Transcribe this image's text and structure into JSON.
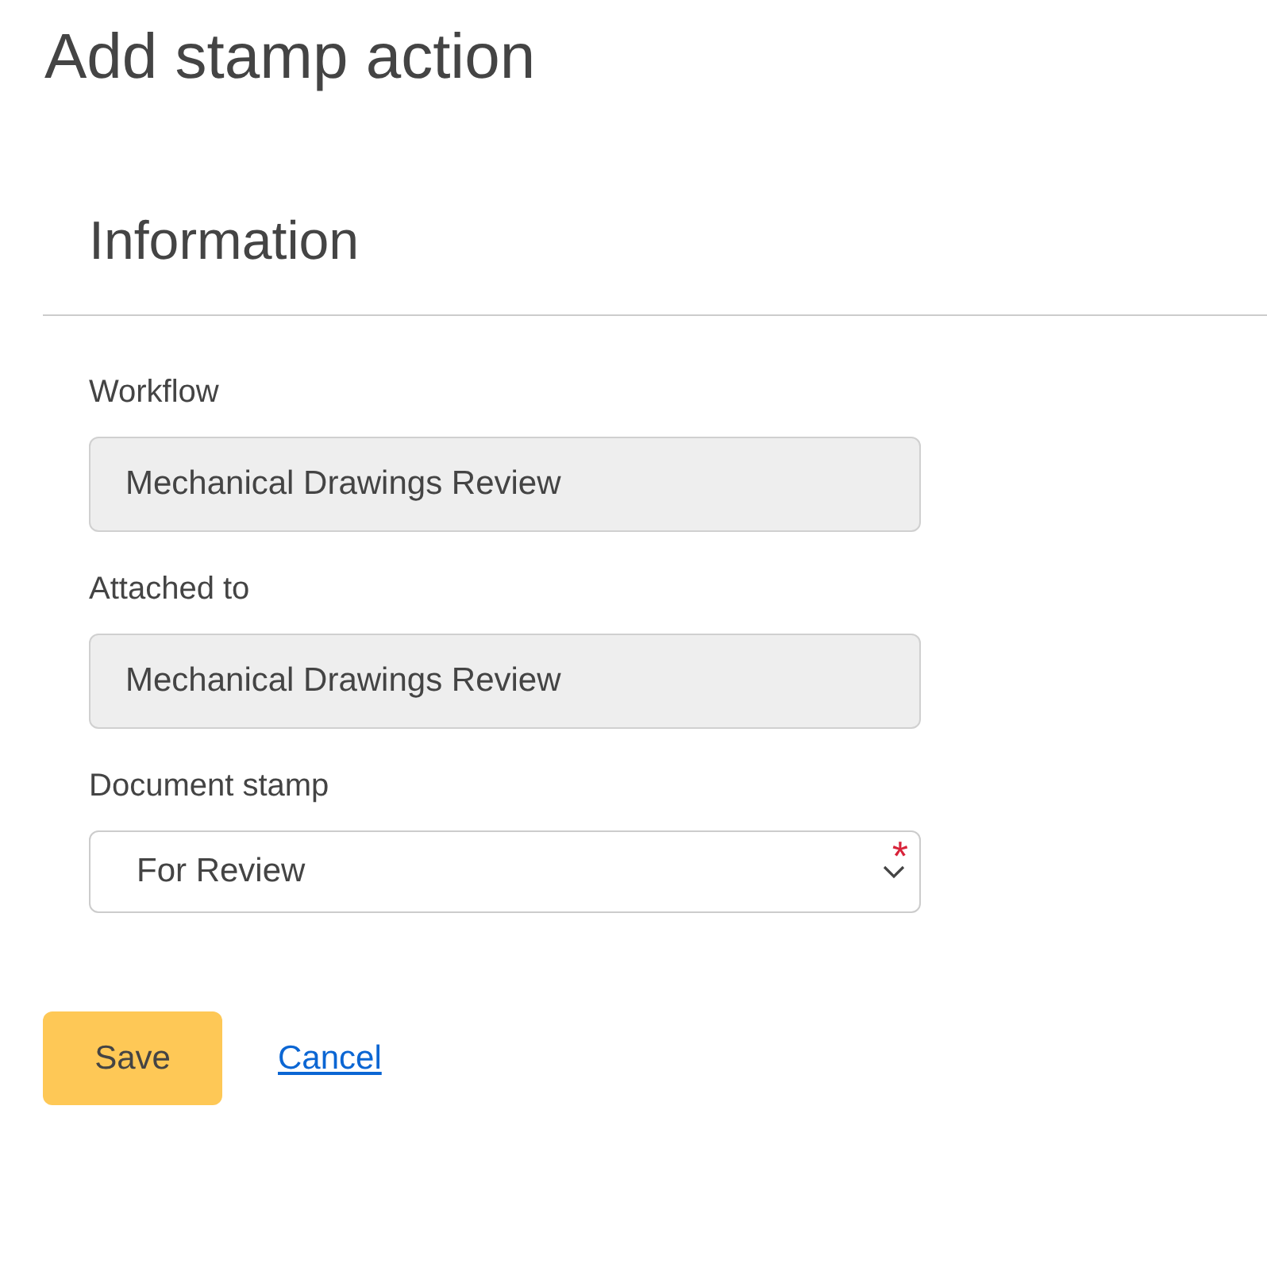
{
  "page_title": "Add stamp action",
  "section": {
    "title": "Information"
  },
  "fields": [
    {
      "kind": "readonly",
      "label": "Workflow",
      "value": "Mechanical Drawings Review"
    },
    {
      "kind": "readonly",
      "label": "Attached to",
      "value": "Mechanical Drawings Review"
    },
    {
      "kind": "select",
      "label": "Document stamp",
      "value": "For Review",
      "required_mark": "*"
    }
  ],
  "buttons": [
    {
      "kind": "primary",
      "label": "Save"
    },
    {
      "kind": "link",
      "label": "Cancel"
    }
  ]
}
